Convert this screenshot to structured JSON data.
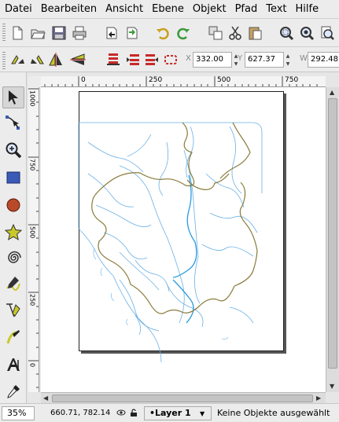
{
  "menubar": {
    "items": [
      "Datei",
      "Bearbeiten",
      "Ansicht",
      "Ebene",
      "Objekt",
      "Pfad",
      "Text",
      "Hilfe"
    ]
  },
  "command_bar": {
    "icons": [
      "new-document-icon",
      "open-document-icon",
      "save-document-icon",
      "print-icon",
      "import-icon",
      "export-icon",
      "undo-icon",
      "redo-icon",
      "duplicate-icon",
      "cut-icon",
      "paste-icon",
      "zoom-selection-icon",
      "zoom-drawing-icon",
      "zoom-page-icon"
    ]
  },
  "tool_controls": {
    "x_label": "X",
    "x_value": "332.00",
    "y_label": "Y",
    "y_value": "627.37",
    "w_label": "W",
    "w_value": "292.48"
  },
  "rulers": {
    "top_ticks": [
      "0",
      "250",
      "500",
      "750"
    ],
    "left_ticks": [
      "1000",
      "750",
      "500",
      "250",
      "0"
    ]
  },
  "toolbox": {
    "tools": [
      "selector-tool-icon",
      "node-tool-icon",
      "zoom-tool-icon",
      "rectangle-tool-icon",
      "ellipse-tool-icon",
      "star-tool-icon",
      "spiral-tool-icon",
      "pencil-tool-icon",
      "pen-tool-icon",
      "calligraphy-tool-icon",
      "text-tool-icon",
      "dropper-tool-icon"
    ]
  },
  "statusbar": {
    "zoom": "35%",
    "coords": "660.71, 782.14",
    "layer": "•Layer 1",
    "message": "Keine Objekte ausgewählt"
  },
  "colors": {
    "river": "#5aa8e0",
    "border": "#8a7a3a",
    "rectangle": "#3a5ab8",
    "ellipse": "#b84a2a",
    "star": "#c8c82a"
  }
}
